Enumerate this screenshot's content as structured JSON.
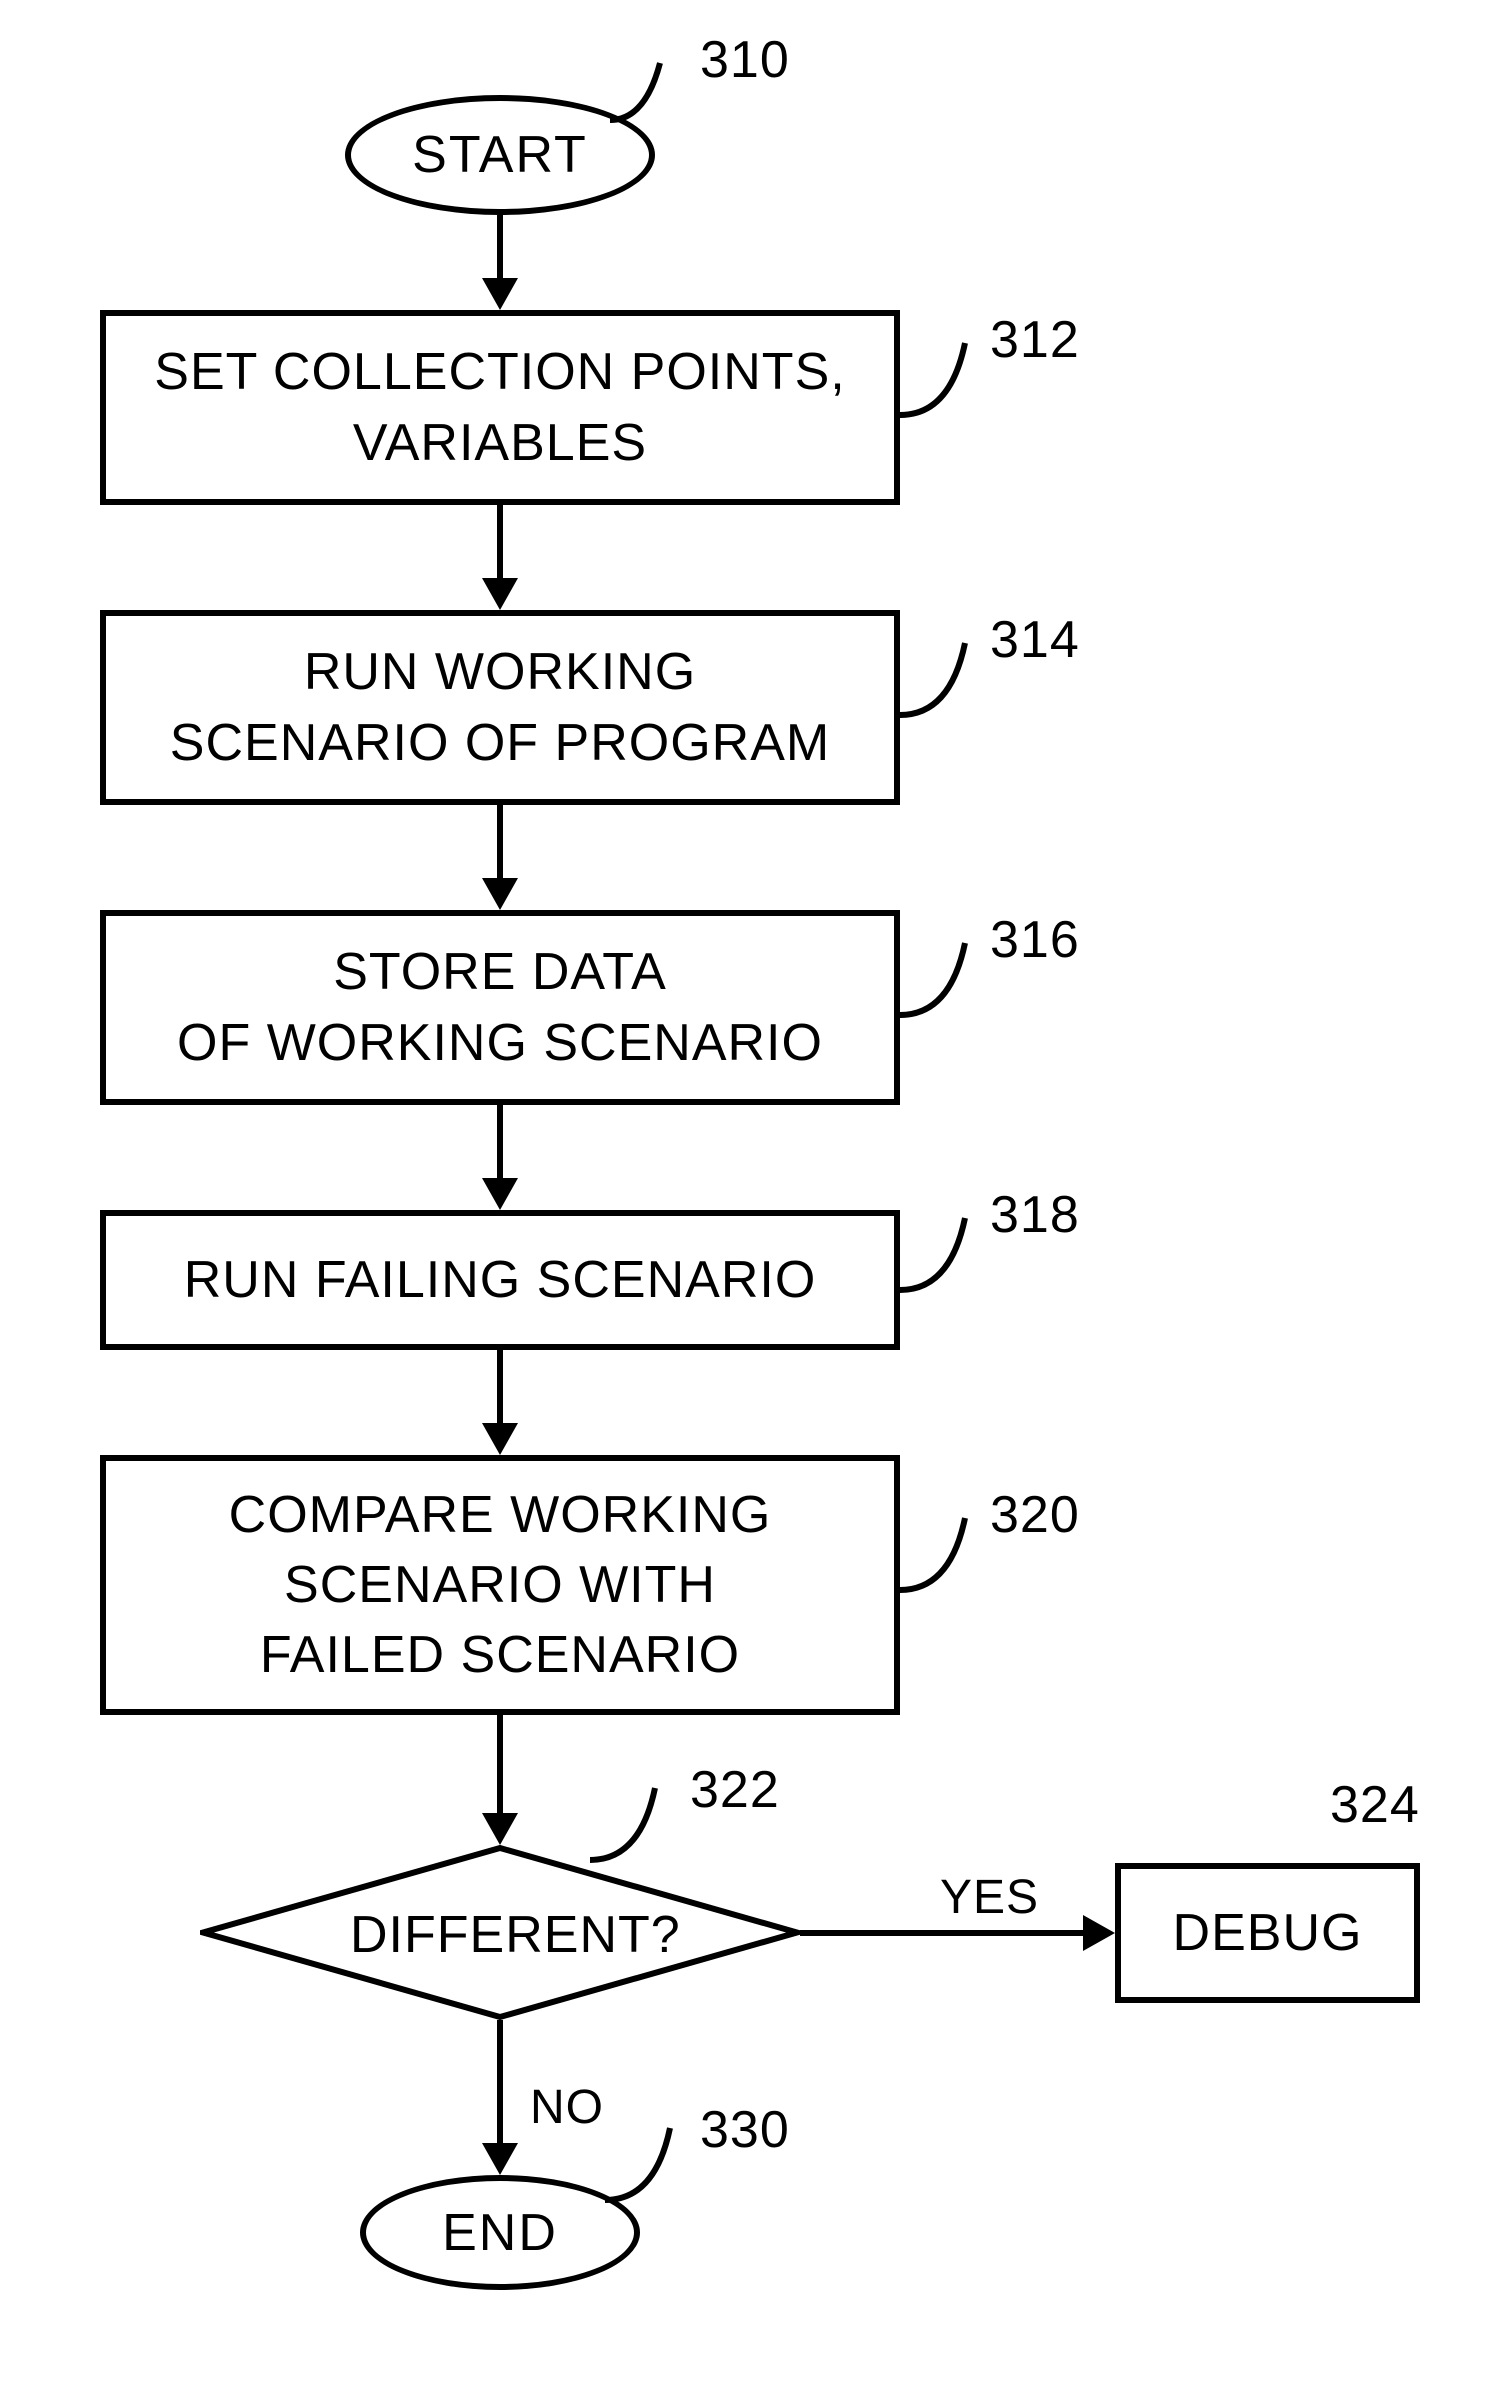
{
  "nodes": {
    "start": {
      "text": "START",
      "ref": "310"
    },
    "step1": {
      "text": "SET COLLECTION POINTS,\nVARIABLES",
      "ref": "312"
    },
    "step2": {
      "text": "RUN WORKING\nSCENARIO OF PROGRAM",
      "ref": "314"
    },
    "step3": {
      "text": "STORE DATA\nOF WORKING SCENARIO",
      "ref": "316"
    },
    "step4": {
      "text": "RUN FAILING SCENARIO",
      "ref": "318"
    },
    "step5": {
      "text": "COMPARE WORKING\nSCENARIO WITH\nFAILED SCENARIO",
      "ref": "320"
    },
    "decision": {
      "text": "DIFFERENT?",
      "ref": "322"
    },
    "debug": {
      "text": "DEBUG",
      "ref": "324"
    },
    "end": {
      "text": "END",
      "ref": "330"
    }
  },
  "edges": {
    "yes": "YES",
    "no": "NO"
  }
}
